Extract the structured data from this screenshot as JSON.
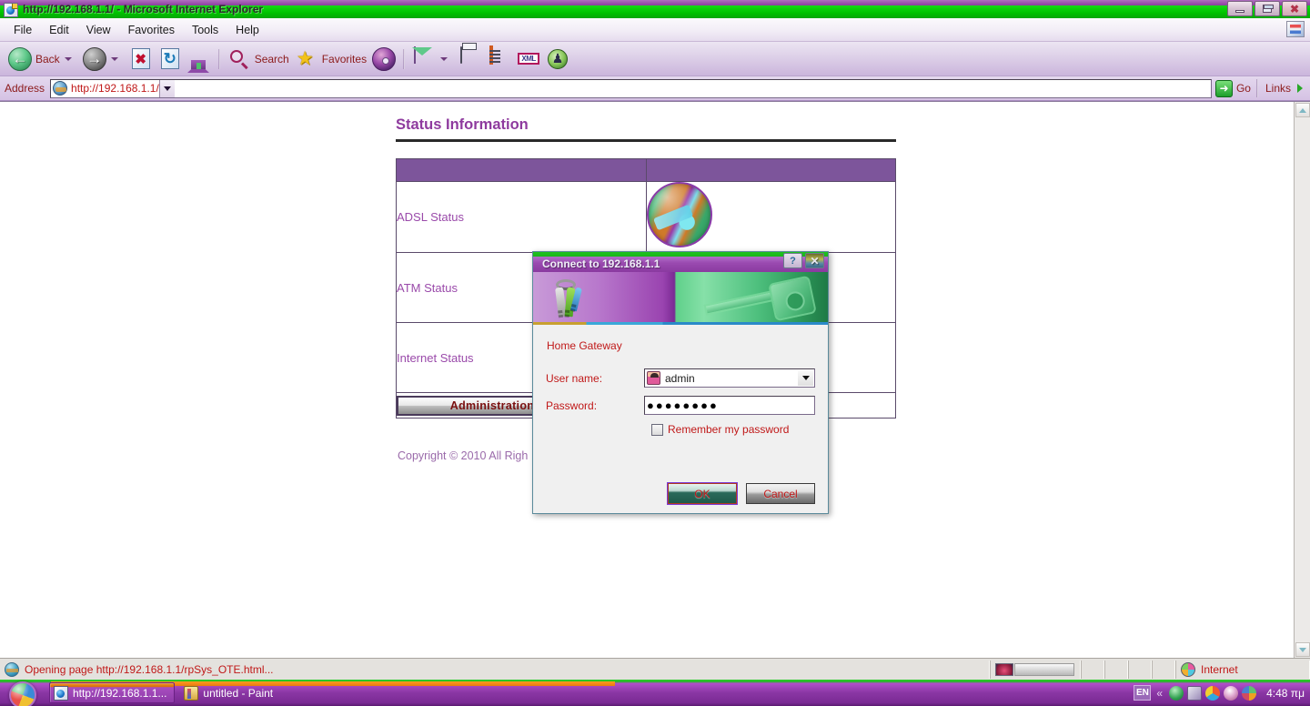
{
  "window": {
    "title": "http://192.168.1.1/ - Microsoft Internet Explorer",
    "icon": "ie-document-icon",
    "controls": {
      "minimize": "Minimize",
      "restore": "Restore",
      "close": "Close"
    }
  },
  "menubar": {
    "items": [
      {
        "label": "File"
      },
      {
        "label": "Edit"
      },
      {
        "label": "View"
      },
      {
        "label": "Favorites"
      },
      {
        "label": "Tools"
      },
      {
        "label": "Help"
      }
    ]
  },
  "toolbar": {
    "back_label": "Back",
    "search_label": "Search",
    "favorites_label": "Favorites",
    "xml_label": "XML",
    "icons": [
      "back-icon",
      "forward-icon",
      "stop-icon",
      "refresh-icon",
      "home-icon",
      "search-icon",
      "favorites-icon",
      "media-icon",
      "mail-icon",
      "print-icon",
      "edit-icon",
      "xml-icon",
      "messenger-icon"
    ]
  },
  "address_bar": {
    "label": "Address",
    "value": "http://192.168.1.1/",
    "go_label": "Go",
    "links_label": "Links"
  },
  "page": {
    "heading": "Status Information",
    "table": {
      "rows": [
        {
          "label": "ADSL Status",
          "value_icon": "globe-image"
        },
        {
          "label": "ATM Status",
          "value_icon": ""
        },
        {
          "label": "Internet Status",
          "value_icon": ""
        }
      ],
      "admin_button": "Administration"
    },
    "copyright": "Copyright © 2010 All Righ"
  },
  "dialog": {
    "title": "Connect to 192.168.1.1",
    "realm": "Home Gateway",
    "username_label": "User name:",
    "username_value": "admin",
    "password_label": "Password:",
    "password_value": "●●●●●●●●",
    "remember_label": "Remember my password",
    "remember_checked": false,
    "ok_label": "OK",
    "cancel_label": "Cancel",
    "help_label": "?",
    "close_label": "✕"
  },
  "statusbar": {
    "message": "Opening page http://192.168.1.1/rpSys_OTE.html...",
    "zone": "Internet"
  },
  "taskbar": {
    "start_label": "",
    "buttons": [
      {
        "label": "http://192.168.1.1...",
        "icon": "ie-icon",
        "active": true
      },
      {
        "label": "untitled - Paint",
        "icon": "paint-icon",
        "active": false
      }
    ],
    "tray": {
      "language": "EN",
      "chevron": "«",
      "clock": "4:48 πμ"
    }
  },
  "colors": {
    "title_green": "#00c400",
    "title_purple": "#8a3f9e",
    "table_header_purple": "#7d559b",
    "heading_purple": "#8e3a9e",
    "link_red": "#c01818",
    "toolbar_lavender": "#cbb5dc"
  }
}
